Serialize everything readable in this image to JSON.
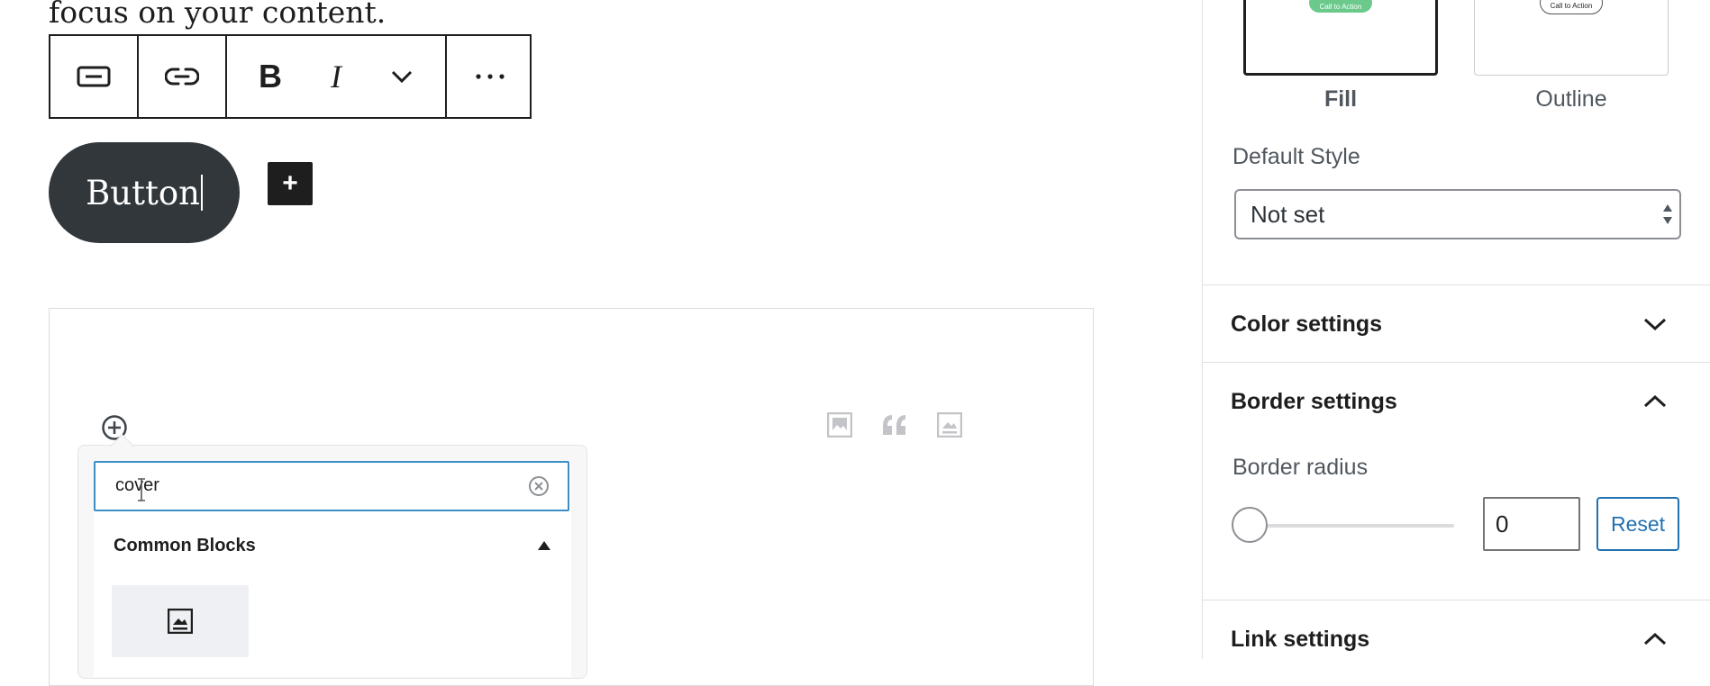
{
  "editor": {
    "intro_text": "focus on your content.",
    "button_text": "Button",
    "toolbar": {
      "bold_label": "B",
      "italic_label": "I",
      "more_label": "⋯"
    },
    "add_label": "+"
  },
  "inserter": {
    "search_value": "cover",
    "section_title": "Common Blocks"
  },
  "sidebar": {
    "styles": [
      {
        "label": "Fill",
        "preview_text": "Call to Action",
        "selected": true
      },
      {
        "label": "Outline",
        "preview_text": "Call to Action",
        "selected": false
      }
    ],
    "default_style": {
      "label": "Default Style",
      "value": "Not set"
    },
    "panels": {
      "color": {
        "title": "Color settings",
        "expanded": false
      },
      "border": {
        "title": "Border settings",
        "expanded": true,
        "radius_label": "Border radius",
        "radius_value": "0",
        "reset_label": "Reset"
      },
      "link": {
        "title": "Link settings",
        "expanded": true
      }
    }
  },
  "colors": {
    "accent": "#2271b1",
    "button_bg": "#32373c",
    "search_focus": "#3c8ec5",
    "fill_preview": "#6bc98c"
  },
  "icons": [
    "button-icon",
    "link-icon",
    "chevron-down-icon",
    "more-icon",
    "plus-icon",
    "image-icon",
    "quote-icon",
    "cover-icon",
    "clear-icon",
    "triangle-up-icon",
    "chevron-up-icon"
  ]
}
